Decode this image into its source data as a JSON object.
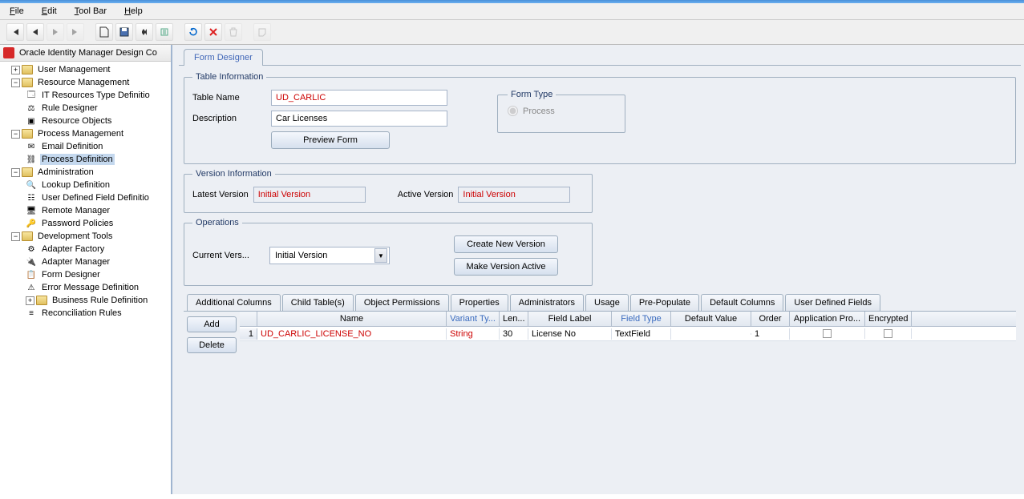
{
  "menu": {
    "file": "File",
    "edit": "Edit",
    "toolbar": "Tool Bar",
    "help": "Help"
  },
  "tree": {
    "root": "Oracle Identity Manager Design Co",
    "user_mgmt": "User Management",
    "resource_mgmt": "Resource Management",
    "it_resources": "IT Resources Type Definitio",
    "rule_designer": "Rule Designer",
    "resource_objects": "Resource Objects",
    "process_mgmt": "Process Management",
    "email_def": "Email Definition",
    "process_def": "Process Definition",
    "administration": "Administration",
    "lookup_def": "Lookup Definition",
    "udf_def": "User Defined Field Definitio",
    "remote_mgr": "Remote Manager",
    "pwd_policies": "Password Policies",
    "dev_tools": "Development Tools",
    "adapter_factory": "Adapter Factory",
    "adapter_manager": "Adapter Manager",
    "form_designer": "Form Designer",
    "err_msg_def": "Error Message Definition",
    "biz_rule_def": "Business Rule Definition",
    "recon_rules": "Reconciliation Rules"
  },
  "main_tab": "Form Designer",
  "table_info": {
    "legend": "Table Information",
    "table_name_label": "Table Name",
    "table_name_value": "UD_CARLIC",
    "description_label": "Description",
    "description_value": "Car Licenses",
    "preview_btn": "Preview Form"
  },
  "form_type": {
    "legend": "Form Type",
    "process": "Process"
  },
  "version_info": {
    "legend": "Version Information",
    "latest_label": "Latest Version",
    "latest_value": "Initial Version",
    "active_label": "Active Version",
    "active_value": "Initial Version"
  },
  "operations": {
    "legend": "Operations",
    "current_label": "Current Vers...",
    "current_value": "Initial Version",
    "create_btn": "Create New Version",
    "active_btn": "Make Version Active"
  },
  "sub_tabs": {
    "additional_columns": "Additional Columns",
    "child_tables": "Child Table(s)",
    "object_permissions": "Object Permissions",
    "properties": "Properties",
    "administrators": "Administrators",
    "usage": "Usage",
    "prepopulate": "Pre-Populate",
    "default_columns": "Default Columns",
    "user_defined_fields": "User Defined Fields"
  },
  "grid_actions": {
    "add": "Add",
    "delete": "Delete"
  },
  "grid": {
    "headers": {
      "name": "Name",
      "variant": "Variant Ty...",
      "len": "Len...",
      "field_label": "Field Label",
      "field_type": "Field Type",
      "default_value": "Default Value",
      "order": "Order",
      "app_profile": "Application Pro...",
      "encrypted": "Encrypted"
    },
    "rows": [
      {
        "num": "1",
        "name": "UD_CARLIC_LICENSE_NO",
        "variant": "String",
        "len": "30",
        "field_label": "License No",
        "field_type": "TextField",
        "default_value": "",
        "order": "1"
      }
    ]
  }
}
